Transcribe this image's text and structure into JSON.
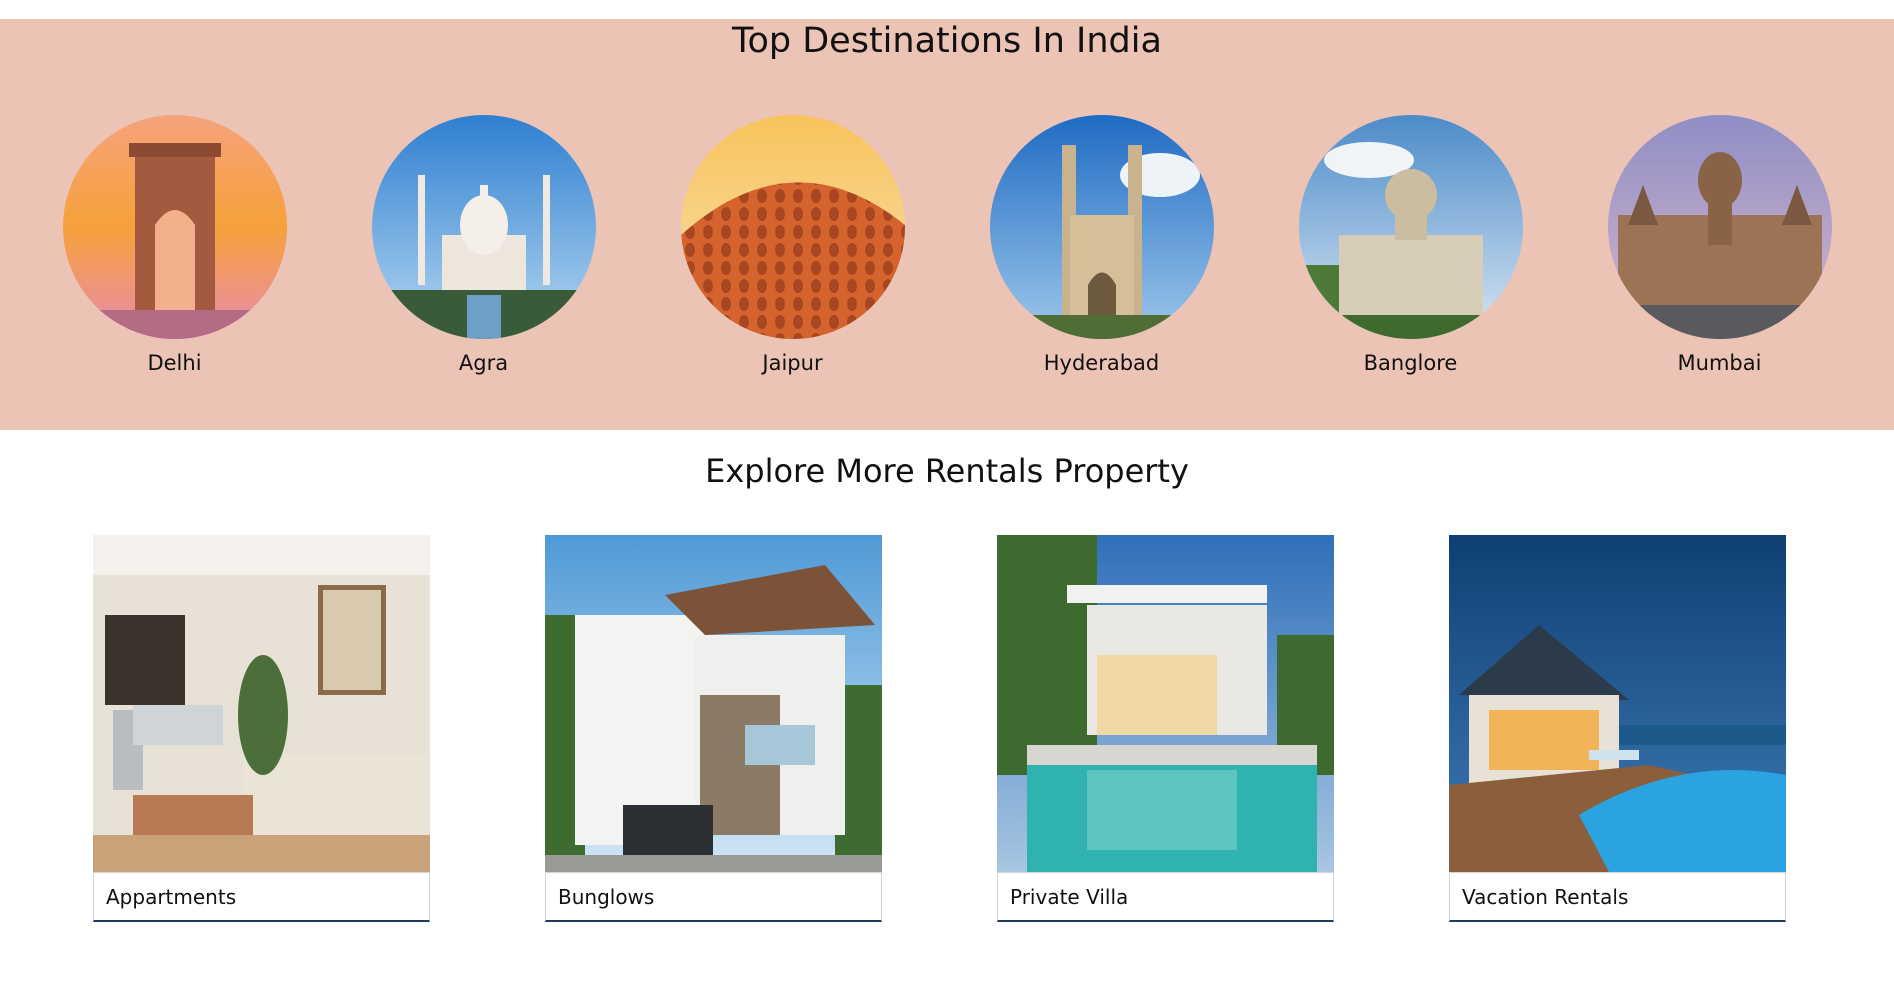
{
  "destinations": {
    "title": "Top Destinations In India",
    "items": [
      {
        "label": "Delhi",
        "icon": "india-gate-image"
      },
      {
        "label": "Agra",
        "icon": "taj-mahal-image"
      },
      {
        "label": "Jaipur",
        "icon": "hawa-mahal-image"
      },
      {
        "label": "Hyderabad",
        "icon": "charminar-image"
      },
      {
        "label": "Banglore",
        "icon": "vidhana-soudha-image"
      },
      {
        "label": "Mumbai",
        "icon": "cst-station-image"
      }
    ]
  },
  "rentals": {
    "title": "Explore More Rentals Property",
    "items": [
      {
        "label": "Appartments",
        "icon": "apartment-interior-image"
      },
      {
        "label": "Bunglows",
        "icon": "bungalow-exterior-image"
      },
      {
        "label": "Private Villa",
        "icon": "villa-pool-image"
      },
      {
        "label": "Vacation Rentals",
        "icon": "resort-pool-image"
      }
    ]
  },
  "colors": {
    "dest_background": "#ecc4b5",
    "label_underline": "#1d3a5f"
  }
}
